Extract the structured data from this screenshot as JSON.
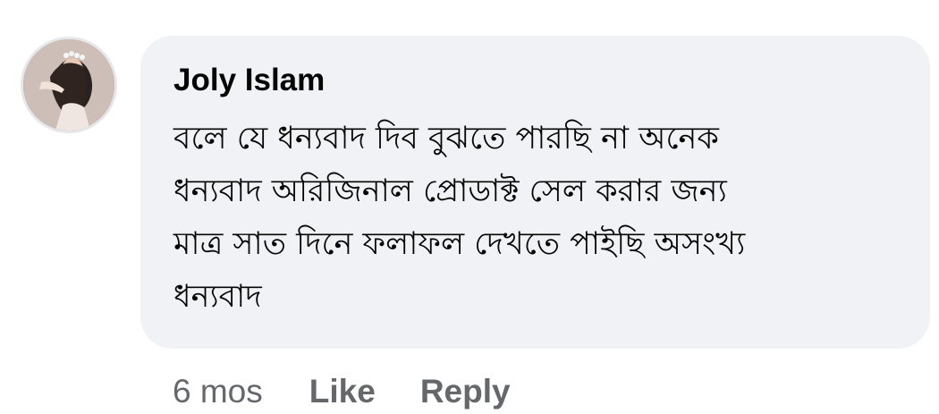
{
  "comment": {
    "author": "Joly Islam",
    "text_lines": [
      "বলে যে ধন্যবাদ দিব বুঝতে পারছি না অনেক",
      "ধন্যবাদ অরিজিনাল প্রোডাক্ট সেল করার জন্য",
      "মাত্র সাত দিনে ফলাফল দেখতে পাইছি অসংখ্য",
      "ধন্যবাদ"
    ],
    "timestamp": "6 mos",
    "like_label": "Like",
    "reply_label": "Reply"
  },
  "colors": {
    "bubble_background": "#f0f2f5",
    "meta_text": "#65676b",
    "main_text": "#050505"
  }
}
